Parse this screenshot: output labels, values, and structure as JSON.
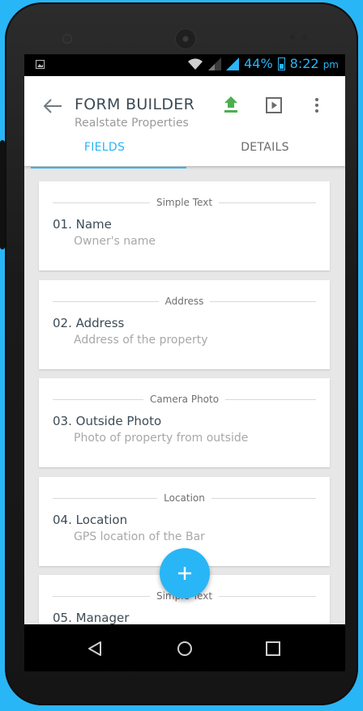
{
  "status_bar": {
    "battery_percent": "44%",
    "time": "8:22",
    "ampm": "pm",
    "accent": "#29b6f6"
  },
  "app_bar": {
    "title": "FORM BUILDER",
    "subtitle": "Realstate Properties",
    "actions": [
      "upload-icon",
      "play-icon",
      "more-vert-icon"
    ]
  },
  "tabs": [
    {
      "label": "FIELDS",
      "active": true
    },
    {
      "label": "DETAILS",
      "active": false
    }
  ],
  "fields": [
    {
      "type": "Simple Text",
      "number": "01.",
      "name": "Name",
      "description": "Owner's name"
    },
    {
      "type": "Address",
      "number": "02.",
      "name": "Address",
      "description": "Address of the property"
    },
    {
      "type": "Camera Photo",
      "number": "03.",
      "name": "Outside Photo",
      "description": "Photo of property from outside"
    },
    {
      "type": "Location",
      "number": "04.",
      "name": "Location",
      "description": "GPS location of the Bar"
    },
    {
      "type": "Simple Text",
      "number": "05.",
      "name": "Manager",
      "description": ""
    }
  ],
  "fab": {
    "icon": "plus-icon",
    "color": "#29b6f6"
  },
  "nav_bar": [
    "back-nav-icon",
    "home-nav-icon",
    "recents-nav-icon"
  ]
}
